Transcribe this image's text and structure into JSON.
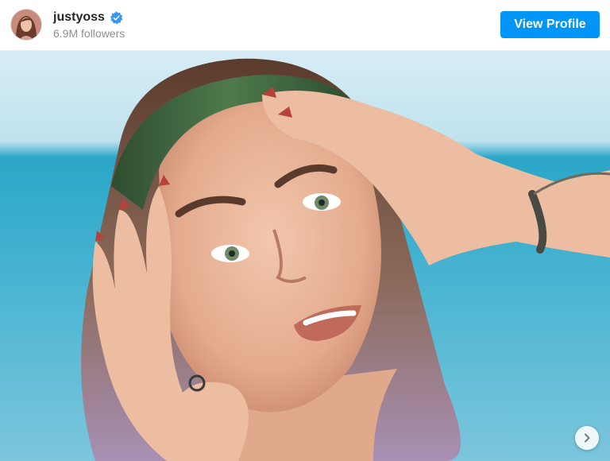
{
  "header": {
    "username": "justyoss",
    "verified_icon": "verified-badge-icon",
    "followers_text": "6.9M followers",
    "view_profile_label": "View Profile"
  },
  "post": {
    "carousel_next_icon": "chevron-right-icon"
  },
  "colors": {
    "accent": "#0095f6",
    "verified": "#3897f0",
    "username": "#262626",
    "secondary_text": "#8e8e8e"
  }
}
